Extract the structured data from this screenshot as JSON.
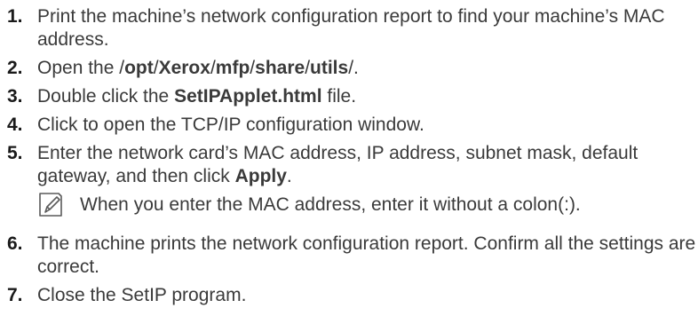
{
  "steps": [
    {
      "number": "1.",
      "text": "Print the machine’s network configuration report to find your machine’s MAC address."
    },
    {
      "number": "2.",
      "prefix": "Open the /",
      "path": [
        "opt",
        "/",
        "Xerox",
        "/",
        "mfp",
        "/",
        "share",
        "/",
        "utils",
        "/."
      ]
    },
    {
      "number": "3.",
      "prefix": "Double click the ",
      "bold": "SetIPApplet.html",
      "suffix": " file."
    },
    {
      "number": "4.",
      "text": "Click to open the TCP/IP configuration window."
    },
    {
      "number": "5.",
      "prefix": "Enter the network card’s MAC address, IP address, subnet mask, default gateway, and then click ",
      "bold": "Apply",
      "suffix": "."
    },
    {
      "number": "6.",
      "text": "The machine prints the network configuration report. Confirm all the settings are correct."
    },
    {
      "number": "7.",
      "text": "Close the SetIP program."
    }
  ],
  "note": {
    "icon": "note-pencil-icon",
    "text": "When you enter the MAC address, enter it without a colon(:)."
  }
}
